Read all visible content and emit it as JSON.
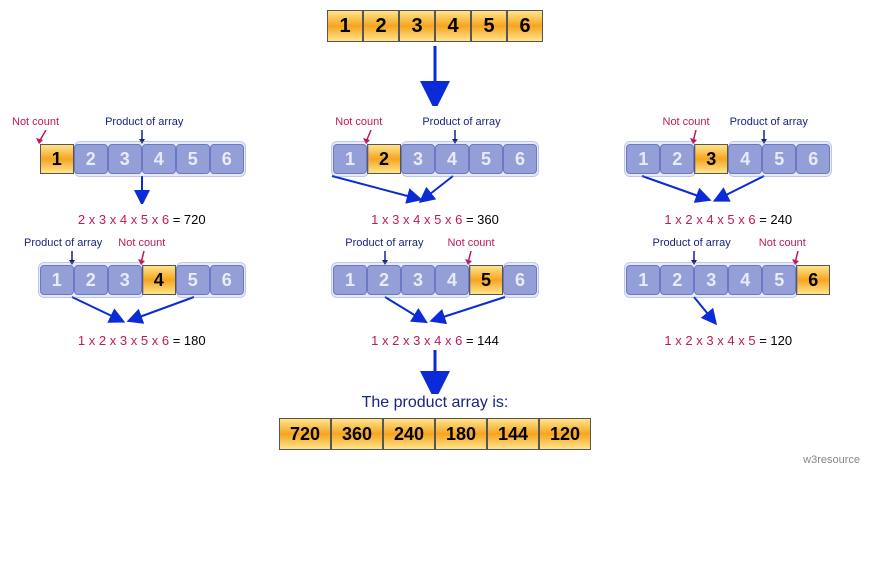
{
  "input_array": [
    "1",
    "2",
    "3",
    "4",
    "5",
    "6"
  ],
  "not_count_label": "Not count",
  "product_label": "Product of array",
  "groups": [
    {
      "skip_index": 0,
      "formula_nums": [
        "2",
        "3",
        "4",
        "5",
        "6"
      ],
      "result": "720"
    },
    {
      "skip_index": 1,
      "formula_nums": [
        "1",
        "3",
        "4",
        "5",
        "6"
      ],
      "result": "360"
    },
    {
      "skip_index": 2,
      "formula_nums": [
        "1",
        "2",
        "4",
        "5",
        "6"
      ],
      "result": "240"
    },
    {
      "skip_index": 3,
      "formula_nums": [
        "1",
        "2",
        "3",
        "5",
        "6"
      ],
      "result": "180"
    },
    {
      "skip_index": 4,
      "formula_nums": [
        "1",
        "2",
        "3",
        "4",
        "6"
      ],
      "result": "144"
    },
    {
      "skip_index": 5,
      "formula_nums": [
        "1",
        "2",
        "3",
        "4",
        "5"
      ],
      "result": "120"
    }
  ],
  "result_title": "The product array is:",
  "result_array": [
    "720",
    "360",
    "240",
    "180",
    "144",
    "120"
  ],
  "credit": "w3resource"
}
